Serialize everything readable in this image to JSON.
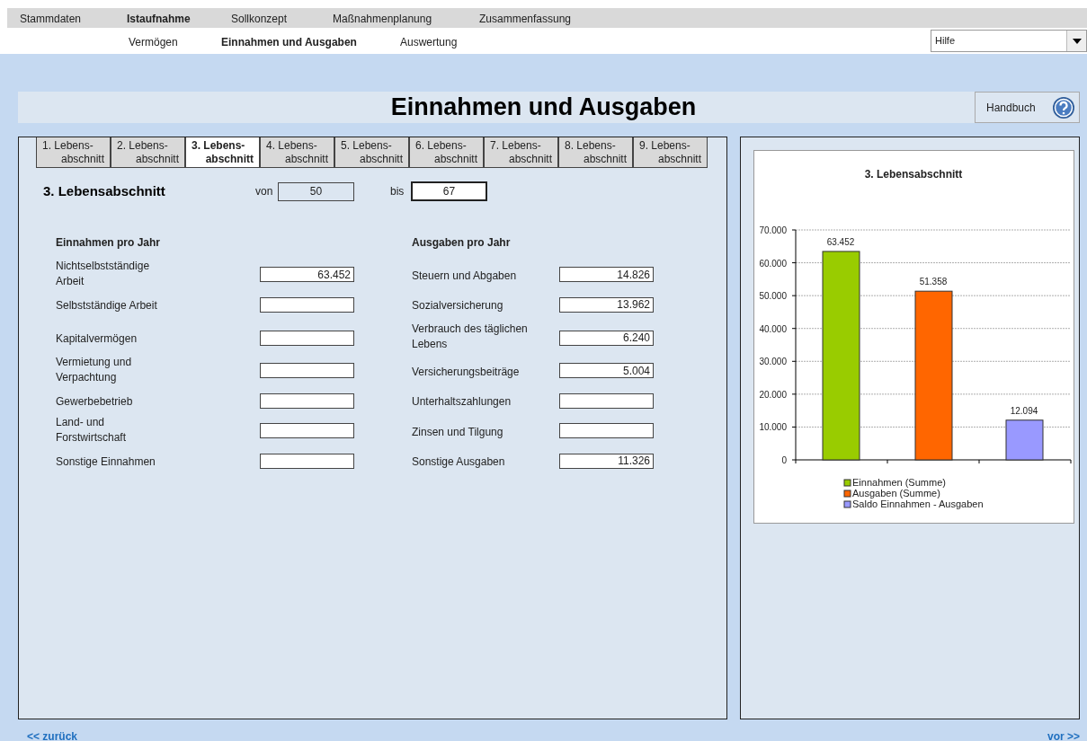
{
  "main_menu": [
    {
      "label": "Stammdaten",
      "selected": false
    },
    {
      "label": "Istaufnahme",
      "selected": true
    },
    {
      "label": "Sollkonzept",
      "selected": false
    },
    {
      "label": "Maßnahmenplanung",
      "selected": false
    },
    {
      "label": "Zusammenfassung",
      "selected": false
    }
  ],
  "sub_menu": [
    {
      "label": "Vermögen",
      "selected": false
    },
    {
      "label": "Einnahmen und Ausgaben",
      "selected": true
    },
    {
      "label": "Auswertung",
      "selected": false
    }
  ],
  "help_dropdown": {
    "value": "Hilfe"
  },
  "page_title": "Einnahmen und Ausgaben",
  "manual_button": "Handbuch",
  "tabs": [
    {
      "line1": "1. Lebens-",
      "line2": "abschnitt",
      "selected": false
    },
    {
      "line1": "2. Lebens-",
      "line2": "abschnitt",
      "selected": false
    },
    {
      "line1": "3. Lebens-",
      "line2": "abschnitt",
      "selected": true
    },
    {
      "line1": "4. Lebens-",
      "line2": "abschnitt",
      "selected": false
    },
    {
      "line1": "5. Lebens-",
      "line2": "abschnitt",
      "selected": false
    },
    {
      "line1": "6. Lebens-",
      "line2": "abschnitt",
      "selected": false
    },
    {
      "line1": "7. Lebens-",
      "line2": "abschnitt",
      "selected": false
    },
    {
      "line1": "8. Lebens-",
      "line2": "abschnitt",
      "selected": false
    },
    {
      "line1": "9. Lebens-",
      "line2": "abschnitt",
      "selected": false
    }
  ],
  "section": {
    "title": "3. Lebensabschnitt",
    "from_label": "von",
    "from_value": "50",
    "to_label": "bis",
    "to_value": "67"
  },
  "income": {
    "heading": "Einnahmen pro Jahr",
    "fields": [
      {
        "label": "Nichtselbstständige Arbeit",
        "value": "63.452"
      },
      {
        "label": "Selbstständige Arbeit"
      },
      {
        "label": "Kapitalvermögen"
      },
      {
        "label": "Vermietung und Verpachtung"
      },
      {
        "label": "Gewerbebetrieb"
      },
      {
        "label": "Land- und Forstwirtschaft"
      },
      {
        "label": "Sonstige Einnahmen"
      }
    ]
  },
  "expenses": {
    "heading": "Ausgaben pro Jahr",
    "fields": [
      {
        "label": "Steuern und Abgaben",
        "value": "14.826"
      },
      {
        "label": "Sozialversicherung",
        "value": "13.962"
      },
      {
        "label": "Verbrauch des täglichen Lebens",
        "value": "6.240"
      },
      {
        "label": "Versicherungsbeiträge",
        "value": "5.004"
      },
      {
        "label": "Unterhaltszahlungen"
      },
      {
        "label": "Zinsen und Tilgung"
      },
      {
        "label": "Sonstige Ausgaben",
        "value": "11.326"
      }
    ]
  },
  "chart_data": {
    "type": "bar",
    "title": "3. Lebensabschnitt",
    "ylim": [
      0,
      70000
    ],
    "yticks": [
      {
        "value": 0,
        "label": "0"
      },
      {
        "value": 10000,
        "label": "10.000"
      },
      {
        "value": 20000,
        "label": "20.000"
      },
      {
        "value": 30000,
        "label": "30.000"
      },
      {
        "value": 40000,
        "label": "40.000"
      },
      {
        "value": 50000,
        "label": "50.000"
      },
      {
        "value": 60000,
        "label": "60.000"
      },
      {
        "value": 70000,
        "label": "70.000"
      }
    ],
    "data_labels": true,
    "grid": true,
    "legend": "bottom",
    "series": [
      {
        "name": "Einnahmen (Summe)",
        "color": "#99cc00",
        "values": [
          63452
        ],
        "value_labels": [
          "63.452"
        ]
      },
      {
        "name": "Ausgaben (Summe)",
        "color": "#ff6600",
        "values": [
          51358
        ],
        "value_labels": [
          "51.358"
        ]
      },
      {
        "name": "Saldo Einnahmen - Ausgaben",
        "color": "#9999ff",
        "values": [
          12094
        ],
        "value_labels": [
          "12.094"
        ]
      }
    ]
  },
  "nav": {
    "back": "<< zurück",
    "next": "vor >>"
  }
}
